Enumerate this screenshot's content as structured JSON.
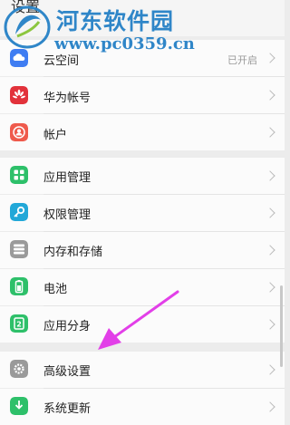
{
  "header": {
    "title": "设置"
  },
  "watermark": {
    "name": "河东软件园",
    "url": "www.pc0359.cn"
  },
  "groups": [
    [
      {
        "label": "云空间",
        "value": "已开启",
        "icon": "cloud-icon",
        "color": "#3f7df2"
      },
      {
        "label": "华为帐号",
        "value": "",
        "icon": "huawei-account-icon",
        "color": "#e2323b"
      },
      {
        "label": "帐户",
        "value": "",
        "icon": "account-icon",
        "color": "#ef5a4c"
      }
    ],
    [
      {
        "label": "应用管理",
        "value": "",
        "icon": "app-grid-icon",
        "color": "#2ec06a"
      },
      {
        "label": "权限管理",
        "value": "",
        "icon": "key-icon",
        "color": "#22a8d8"
      },
      {
        "label": "内存和存储",
        "value": "",
        "icon": "storage-icon",
        "color": "#9a9a9a"
      },
      {
        "label": "电池",
        "value": "",
        "icon": "battery-icon",
        "color": "#2ec06a"
      },
      {
        "label": "应用分身",
        "value": "",
        "icon": "app-twin-icon",
        "color": "#2ec06a"
      }
    ],
    [
      {
        "label": "高级设置",
        "value": "",
        "icon": "gear-icon",
        "color": "#9a9a9a"
      },
      {
        "label": "系统更新",
        "value": "",
        "icon": "system-update-icon",
        "color": "#2ec06a"
      }
    ]
  ]
}
